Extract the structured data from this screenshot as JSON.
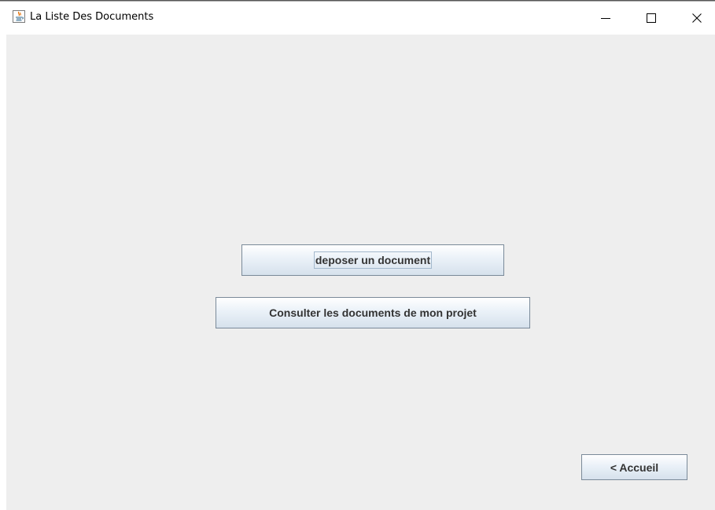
{
  "window": {
    "title": "La Liste Des Documents",
    "icon": "java-icon",
    "controls": [
      "minimize-icon",
      "maximize-icon",
      "close-icon"
    ]
  },
  "main": {
    "deposer_label": "deposer un document",
    "consulter_label": "Consulter les documents de mon projet",
    "accueil_label": "< Accueil"
  }
}
